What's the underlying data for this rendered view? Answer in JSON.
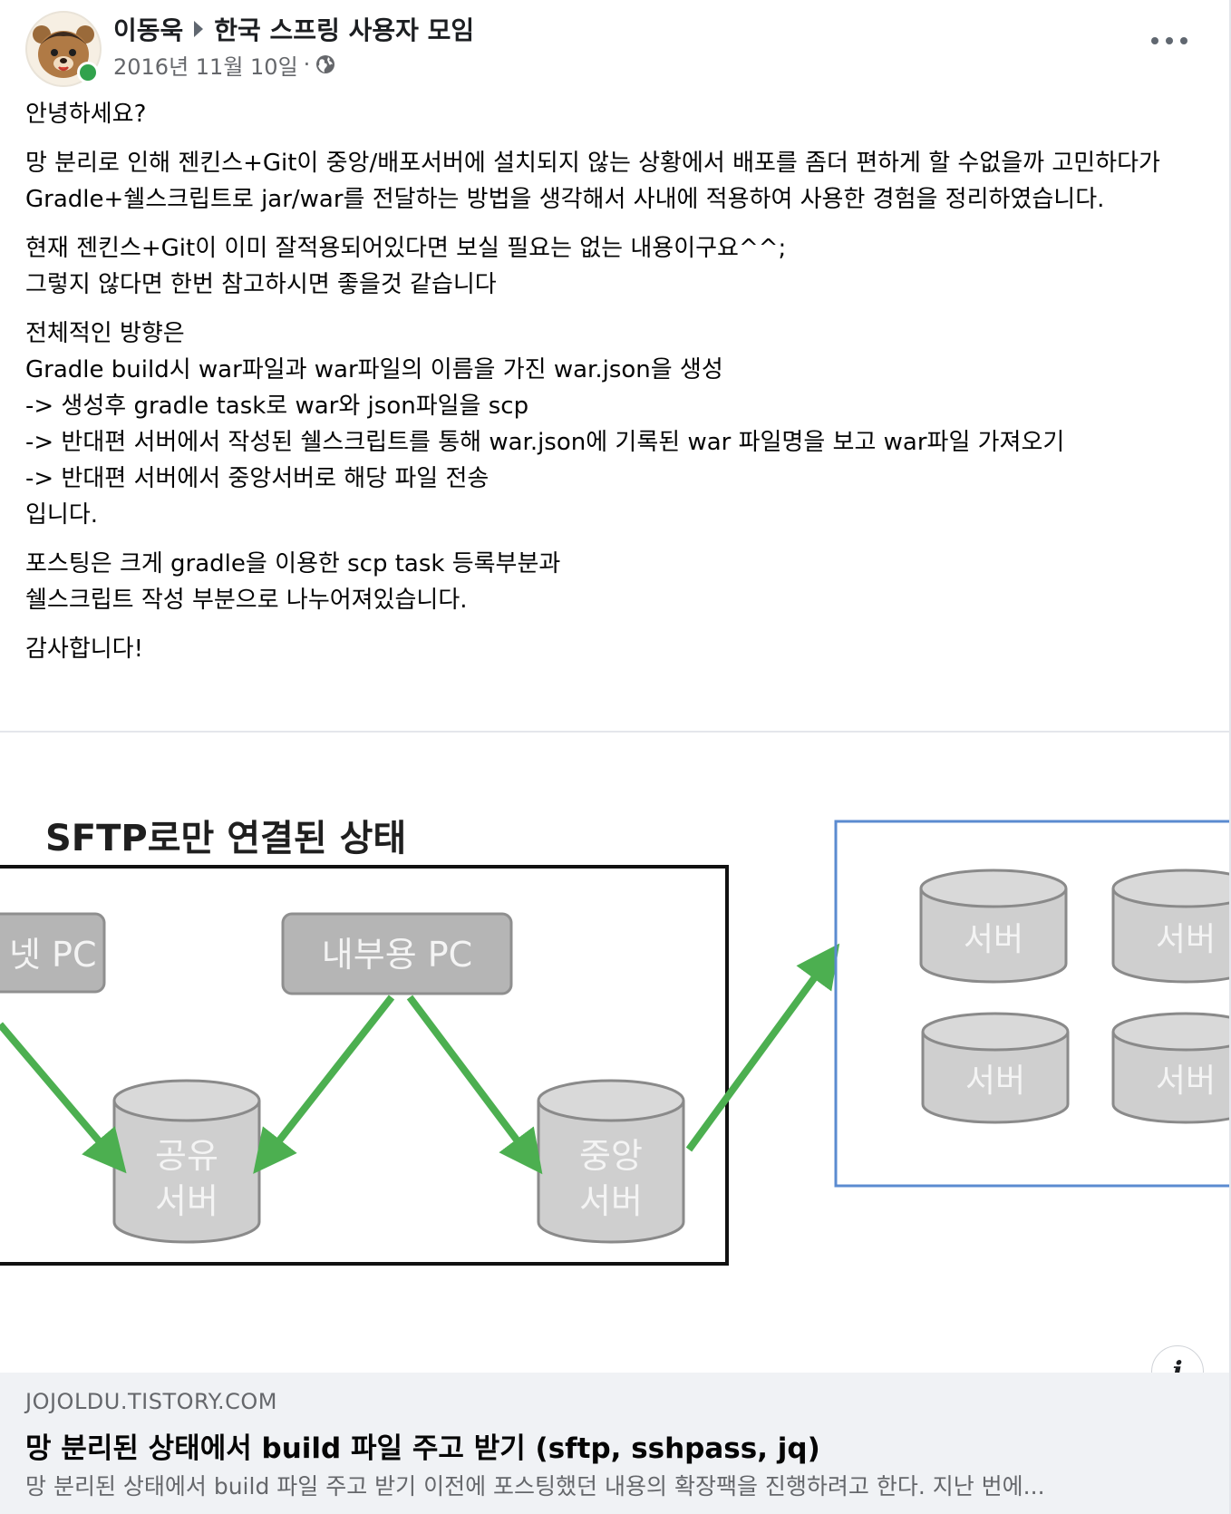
{
  "post": {
    "author": "이동욱",
    "group": "한국 스프링 사용자 모임",
    "date": "2016년 11월 10일",
    "date_separator": "·",
    "privacy_icon": "globe-icon",
    "more_icon": "more-options-icon",
    "paragraphs": [
      {
        "lines": [
          "안녕하세요?"
        ]
      },
      {
        "lines": [
          "망 분리로 인해 젠킨스+Git이 중앙/배포서버에 설치되지 않는 상황에서 배포를 좀더 편하게 할 수없을까 고민하다가 Gradle+쉘스크립트로 jar/war를 전달하는 방법을 생각해서 사내에 적용하여 사용한 경험을 정리하였습니다."
        ]
      },
      {
        "lines": [
          "현재 젠킨스+Git이 이미 잘적용되어있다면 보실 필요는 없는 내용이구요^^;",
          "그렇지 않다면 한번 참고하시면 좋을것 같습니다"
        ]
      },
      {
        "lines": [
          "전체적인 방향은",
          "Gradle build시 war파일과 war파일의 이름을 가진 war.json을 생성",
          "-> 생성후 gradle task로 war와 json파일을 scp",
          "-> 반대편 서버에서 작성된 쉘스크립트를 통해 war.json에 기록된 war 파일명을 보고 war파일 가져오기",
          "-> 반대편 서버에서 중앙서버로 해당 파일 전송",
          "입니다."
        ]
      },
      {
        "lines": [
          "포스팅은 크게 gradle을 이용한 scp task 등록부분과",
          "쉘스크립트 작성 부분으로 나누어져있습니다."
        ]
      },
      {
        "lines": [
          "감사합니다!"
        ]
      }
    ]
  },
  "link_preview": {
    "diagram": {
      "title": "SFTP로만 연결된 상태",
      "left_pc": "넷 PC",
      "internal_pc": "내부용 PC",
      "shared_server_line1": "공유",
      "shared_server_line2": "서버",
      "central_server_line1": "중앙",
      "central_server_line2": "서버",
      "servers": [
        "서버",
        "서버",
        "서버",
        "서버"
      ],
      "arrow_color": "#4caf50",
      "server_fill": "#cfcfcf",
      "box_border_color": "#5b8bd0"
    },
    "info_icon": "info-icon",
    "info_label": "i",
    "domain": "JOJOLDU.TISTORY.COM",
    "title": "망 분리된 상태에서 build 파일 주고 받기 (sftp, sshpass, jq)",
    "description": "망 분리된 상태에서 build 파일 주고 받기 이전에 포스팅했던 내용의 확장팩을 진행하려고 한다. 지난 번에..."
  }
}
